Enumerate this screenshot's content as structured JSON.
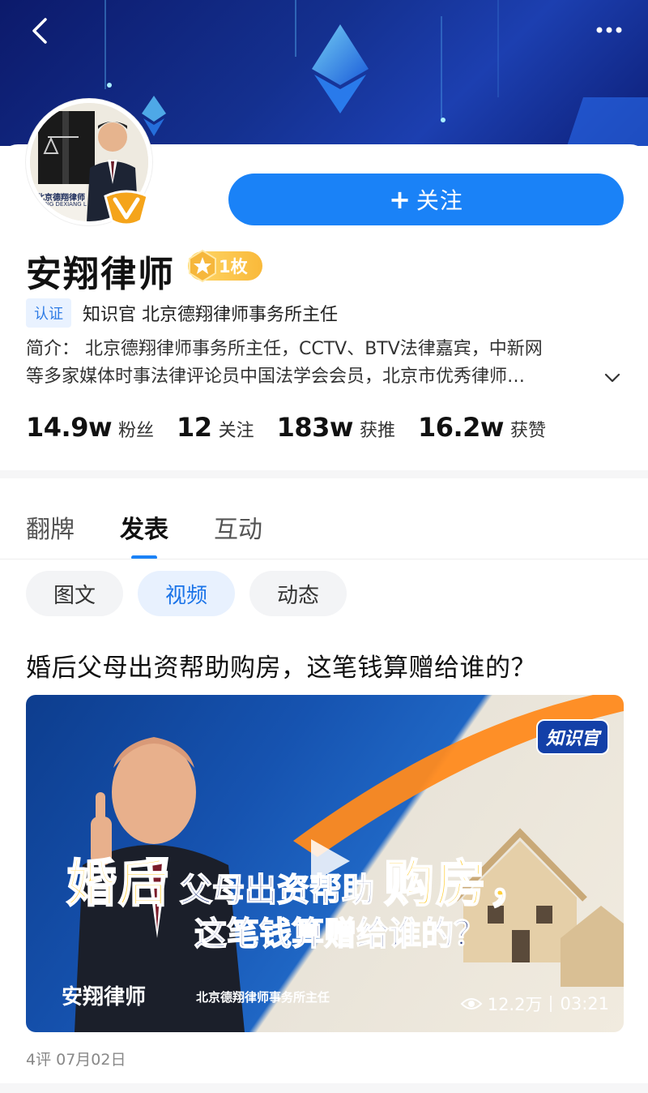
{
  "header": {
    "back_icon": "chevron-left-icon",
    "more_icon": "more-dots-icon"
  },
  "profile": {
    "name": "安翔律师",
    "avatar_logo_text": "北京德翔律师",
    "avatar_logo_sub": "EIJING DEXIANG L",
    "medal_count": "1枚",
    "follow_label": "关注",
    "cert_tag": "认证",
    "cert_text": "知识官 北京德翔律师事务所主任",
    "intro_line1": "简介： 北京德翔律师事务所主任，CCTV、BTV法律嘉宾，中新网",
    "intro_line2": "等多家媒体时事法律评论员中国法学会会员，北京市优秀律师…",
    "stats": [
      {
        "num": "14.9w",
        "label": "粉丝"
      },
      {
        "num": "12",
        "label": "关注"
      },
      {
        "num": "183w",
        "label": "获推"
      },
      {
        "num": "16.2w",
        "label": "获赞"
      }
    ]
  },
  "tabs": [
    {
      "label": "翻牌"
    },
    {
      "label": "发表"
    },
    {
      "label": "互动"
    }
  ],
  "chips": [
    {
      "label": "图文"
    },
    {
      "label": "视频"
    },
    {
      "label": "动态"
    }
  ],
  "post": {
    "title": "婚后父母出资帮助购房，这笔钱算赠给谁的？",
    "cover": {
      "caption_big1": "婚后",
      "caption_mid": "父母出资帮助",
      "caption_big2": "购房，",
      "caption_line2": "这笔钱算赠给谁的？",
      "name": "安翔律师",
      "subtitle": "北京德翔律师事务所主任",
      "logo": "知识官"
    },
    "views": "12.2万",
    "duration": "03:21",
    "meta": "4评  07月02日"
  },
  "colors": {
    "accent": "#1a82f7",
    "banner": "#14308f"
  }
}
